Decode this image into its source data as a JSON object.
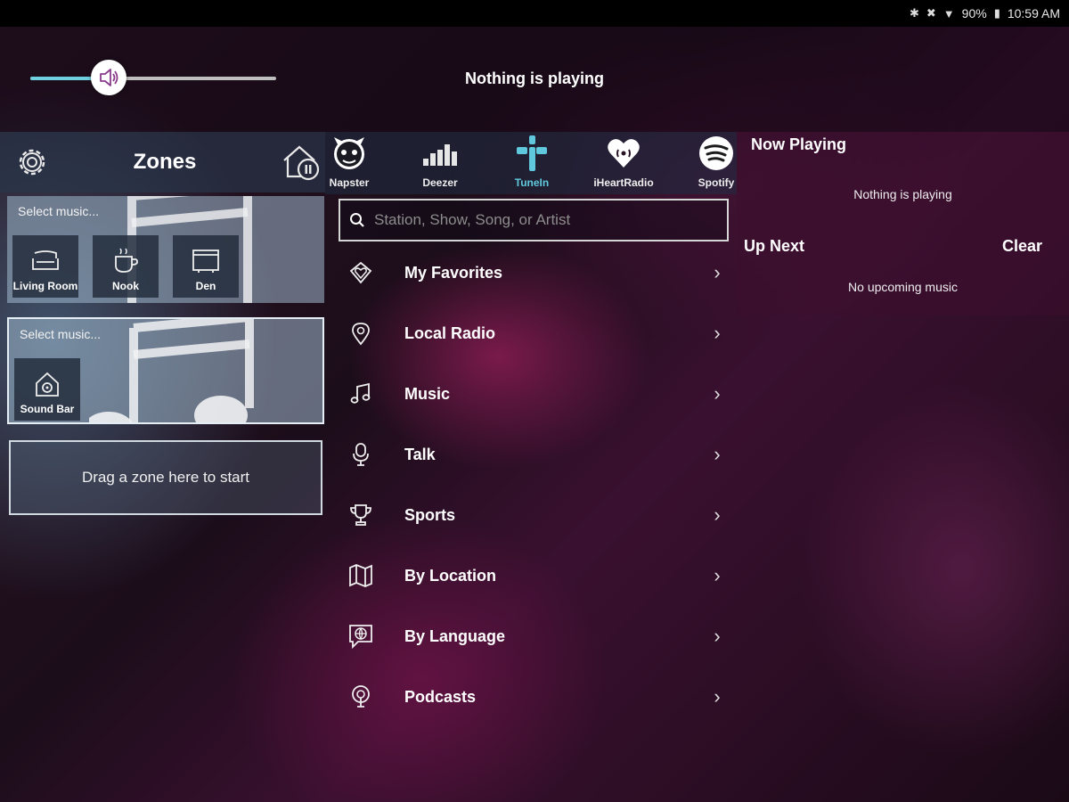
{
  "status_bar": {
    "icons": [
      "bluetooth-icon",
      "mute-icon",
      "wifi-icon",
      "battery-icon"
    ],
    "battery": "90%",
    "time": "10:59 AM"
  },
  "player": {
    "volume_percent": 32,
    "now_playing_text": "Nothing is playing"
  },
  "zones": {
    "title": "Zones",
    "groups": [
      {
        "select_label": "Select music...",
        "tiles": [
          {
            "label": "Living Room",
            "icon": "sofa-icon"
          },
          {
            "label": "Nook",
            "icon": "coffee-cup-icon"
          },
          {
            "label": "Den",
            "icon": "tv-icon"
          }
        ]
      },
      {
        "select_label": "Select music...",
        "tiles": [
          {
            "label": "Sound Bar",
            "icon": "speaker-house-icon"
          }
        ]
      }
    ],
    "drop_text": "Drag a zone here to start"
  },
  "services": {
    "tabs": [
      {
        "label": "Napster",
        "icon": "napster-icon"
      },
      {
        "label": "Deezer",
        "icon": "deezer-icon"
      },
      {
        "label": "TuneIn",
        "icon": "tunein-icon",
        "active": true
      },
      {
        "label": "iHeartRadio",
        "icon": "iheartradio-icon"
      },
      {
        "label": "Spotify",
        "icon": "spotify-icon"
      }
    ],
    "active_color": "#5fc8dc"
  },
  "search": {
    "placeholder": "Station, Show, Song, or Artist"
  },
  "menu": {
    "items": [
      {
        "label": "My Favorites",
        "icon": "heart-diamond-icon"
      },
      {
        "label": "Local Radio",
        "icon": "location-pin-icon"
      },
      {
        "label": "Music",
        "icon": "music-note-icon"
      },
      {
        "label": "Talk",
        "icon": "microphone-icon"
      },
      {
        "label": "Sports",
        "icon": "trophy-icon"
      },
      {
        "label": "By Location",
        "icon": "map-icon"
      },
      {
        "label": "By Language",
        "icon": "globe-chat-icon"
      },
      {
        "label": "Podcasts",
        "icon": "podcast-icon"
      }
    ]
  },
  "now_playing_panel": {
    "heading": "Now Playing",
    "status": "Nothing is playing",
    "up_next": "Up Next",
    "clear": "Clear",
    "no_upcoming": "No upcoming music"
  }
}
